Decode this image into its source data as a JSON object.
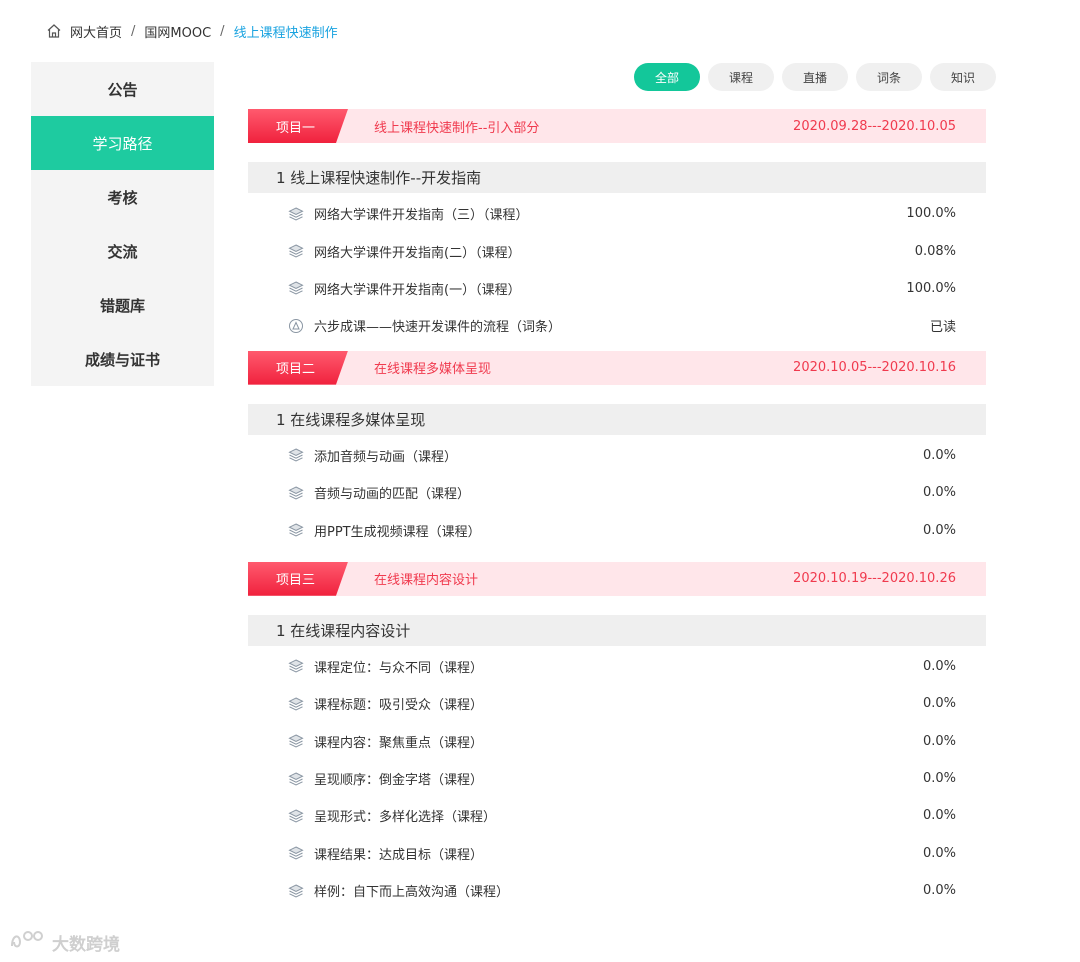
{
  "breadcrumb": {
    "home": "网大首页",
    "level2": "国网MOOC",
    "current": "线上课程快速制作"
  },
  "sidebar": {
    "items": [
      {
        "label": "公告",
        "active": false
      },
      {
        "label": "学习路径",
        "active": true
      },
      {
        "label": "考核",
        "active": false
      },
      {
        "label": "交流",
        "active": false
      },
      {
        "label": "错题库",
        "active": false
      },
      {
        "label": "成绩与证书",
        "active": false
      }
    ]
  },
  "filters": [
    "全部",
    "课程",
    "直播",
    "词条",
    "知识"
  ],
  "projects": [
    {
      "tag": "项目一",
      "title": "线上课程快速制作--引入部分",
      "date": "2020.09.28---2020.10.05",
      "section": "1 线上课程快速制作--开发指南",
      "items": [
        {
          "name": "网络大学课件开发指南（三）（课程）",
          "value": "100.0%",
          "icon": "layers-icon"
        },
        {
          "name": "网络大学课件开发指南(二）（课程）",
          "value": "0.08%",
          "icon": "layers-icon"
        },
        {
          "name": "网络大学课件开发指南(一）（课程）",
          "value": "100.0%",
          "icon": "layers-icon"
        },
        {
          "name": "六步成课——快速开发课件的流程（词条）",
          "value": "已读",
          "icon": "entry-icon"
        }
      ]
    },
    {
      "tag": "项目二",
      "title": "在线课程多媒体呈现",
      "date": "2020.10.05---2020.10.16",
      "section": "1 在线课程多媒体呈现",
      "items": [
        {
          "name": "添加音频与动画（课程）",
          "value": "0.0%",
          "icon": "layers-icon"
        },
        {
          "name": "音频与动画的匹配（课程）",
          "value": "0.0%",
          "icon": "layers-icon"
        },
        {
          "name": "用PPT生成视频课程（课程）",
          "value": "0.0%",
          "icon": "layers-icon"
        }
      ]
    },
    {
      "tag": "项目三",
      "title": "在线课程内容设计",
      "date": "2020.10.19---2020.10.26",
      "section": "1 在线课程内容设计",
      "items": [
        {
          "name": "课程定位：与众不同（课程）",
          "value": "0.0%",
          "icon": "layers-icon"
        },
        {
          "name": "课程标题：吸引受众（课程）",
          "value": "0.0%",
          "icon": "layers-icon"
        },
        {
          "name": "课程内容：聚焦重点（课程）",
          "value": "0.0%",
          "icon": "layers-icon"
        },
        {
          "name": "呈现顺序：倒金字塔（课程）",
          "value": "0.0%",
          "icon": "layers-icon"
        },
        {
          "name": "呈现形式：多样化选择（课程）",
          "value": "0.0%",
          "icon": "layers-icon"
        },
        {
          "name": "课程结果：达成目标（课程）",
          "value": "0.0%",
          "icon": "layers-icon"
        },
        {
          "name": "样例：自下而上高效沟通（课程）",
          "value": "0.0%",
          "icon": "layers-icon"
        }
      ]
    }
  ],
  "watermark": "大数跨境",
  "colors": {
    "accent": "#1ecba0",
    "project_red": "#f03a4e",
    "breadcrumb_current": "#1aa3e0"
  }
}
